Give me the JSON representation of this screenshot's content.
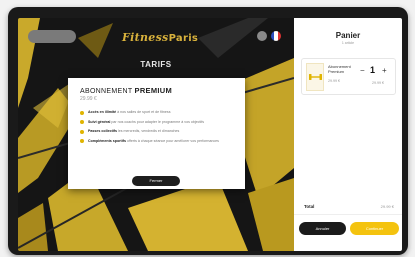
{
  "header": {
    "logo_text": "Fitness",
    "logo_text_bold": "Paris"
  },
  "section_title": "TARIFS",
  "modal": {
    "title_prefix": "ABONNEMENT",
    "title_bold": "PREMIUM",
    "price": "29.99 €",
    "features": [
      {
        "title": "Accès en illimité",
        "text": " à nos salles de sport et de fitness"
      },
      {
        "title": "Suivi général",
        "text": " par nos coachs pour adapter le programme à vos objectifs"
      },
      {
        "title": "Passes collectifs",
        "text": " les mercredis, vendredis et dimanches"
      },
      {
        "title": "Compléments sportifs",
        "text": " offerts à chaque séance pour améliorer vos performances"
      }
    ],
    "button_label": "Fermer"
  },
  "cart": {
    "title": "Panier",
    "subtitle": "1 article",
    "item": {
      "name": "Abonnement Premium",
      "price": "29.99 €",
      "quantity": "1",
      "line_total": "29.99 €"
    },
    "total_label": "Total",
    "total_value": "29.99 €",
    "cancel_label": "Annuler",
    "pay_label": "Continuer"
  },
  "colors": {
    "accent": "#f4c30f",
    "logo": "#d9b23c",
    "dark": "#1b1b1b"
  },
  "icons": {
    "language_en": "uk-flag-icon",
    "language_fr": "france-flag-icon",
    "product": "dumbbell-icon"
  }
}
